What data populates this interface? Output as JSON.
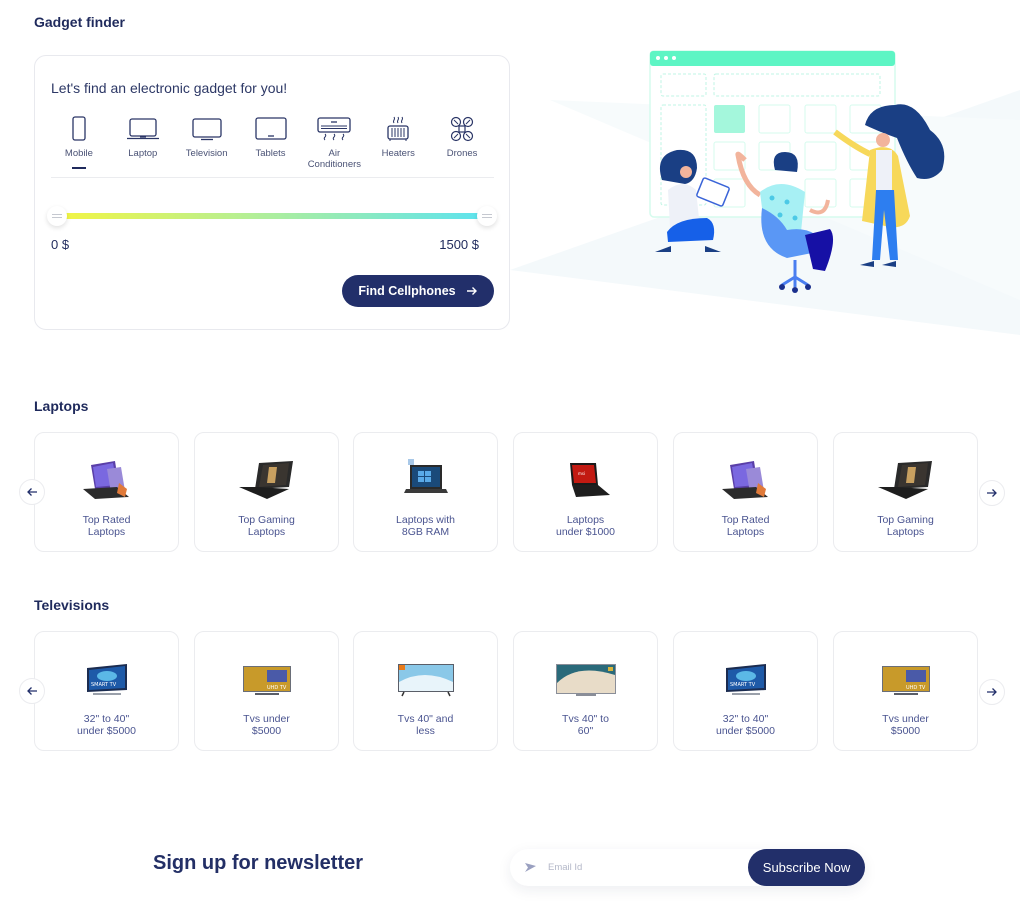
{
  "finder": {
    "section_title": "Gadget finder",
    "lead": "Let's find an electronic gadget for you!",
    "categories": [
      {
        "label": "Mobile",
        "icon": "mobile-icon",
        "selected": true
      },
      {
        "label": "Laptop",
        "icon": "laptop-icon",
        "selected": false
      },
      {
        "label": "Television",
        "icon": "television-icon",
        "selected": false
      },
      {
        "label": "Tablets",
        "icon": "tablet-icon",
        "selected": false
      },
      {
        "label": "Air Conditioners",
        "icon": "air-conditioner-icon",
        "selected": false
      },
      {
        "label": "Heaters",
        "icon": "heater-icon",
        "selected": false
      },
      {
        "label": "Drones",
        "icon": "drone-icon",
        "selected": false
      }
    ],
    "price_range": {
      "min_label": "0 $",
      "max_label": "1500 $",
      "min": 0,
      "max": 1500,
      "low": 0,
      "high": 1500
    },
    "find_button": "Find Cellphones"
  },
  "colors": {
    "primary": "#222f6a",
    "heading": "#1f2a5c",
    "accent_mint": "#5df5c4",
    "slider_start": "#f3f542",
    "slider_end": "#5ce3f0"
  },
  "laptops": {
    "section_title": "Laptops",
    "items": [
      {
        "label": "Top Rated\nLaptops",
        "image": "convertible-laptop"
      },
      {
        "label": "Top Gaming\nLaptops",
        "image": "gaming-laptop"
      },
      {
        "label": "Laptops with\n8GB RAM",
        "image": "windows-laptop"
      },
      {
        "label": "Laptops\nunder $1000",
        "image": "red-laptop"
      },
      {
        "label": "Top Rated\nLaptops",
        "image": "convertible-laptop"
      },
      {
        "label": "Top Gaming\nLaptops",
        "image": "gaming-laptop"
      }
    ]
  },
  "televisions": {
    "section_title": "Televisions",
    "items": [
      {
        "label": "32\" to 40\"\nunder $5000",
        "image": "smart-tv"
      },
      {
        "label": "Tvs under\n$5000",
        "image": "uhd-tv"
      },
      {
        "label": "Tvs 40\" and\nless",
        "image": "surf-tv"
      },
      {
        "label": "Tvs 40\" to\n60\"",
        "image": "wave-tv"
      },
      {
        "label": "32\" to 40\"\nunder $5000",
        "image": "smart-tv"
      },
      {
        "label": "Tvs under\n$5000",
        "image": "uhd-tv"
      }
    ]
  },
  "newsletter": {
    "title": "Sign up for newsletter",
    "placeholder": "Email Id",
    "value": "",
    "button": "Subscribe Now"
  }
}
